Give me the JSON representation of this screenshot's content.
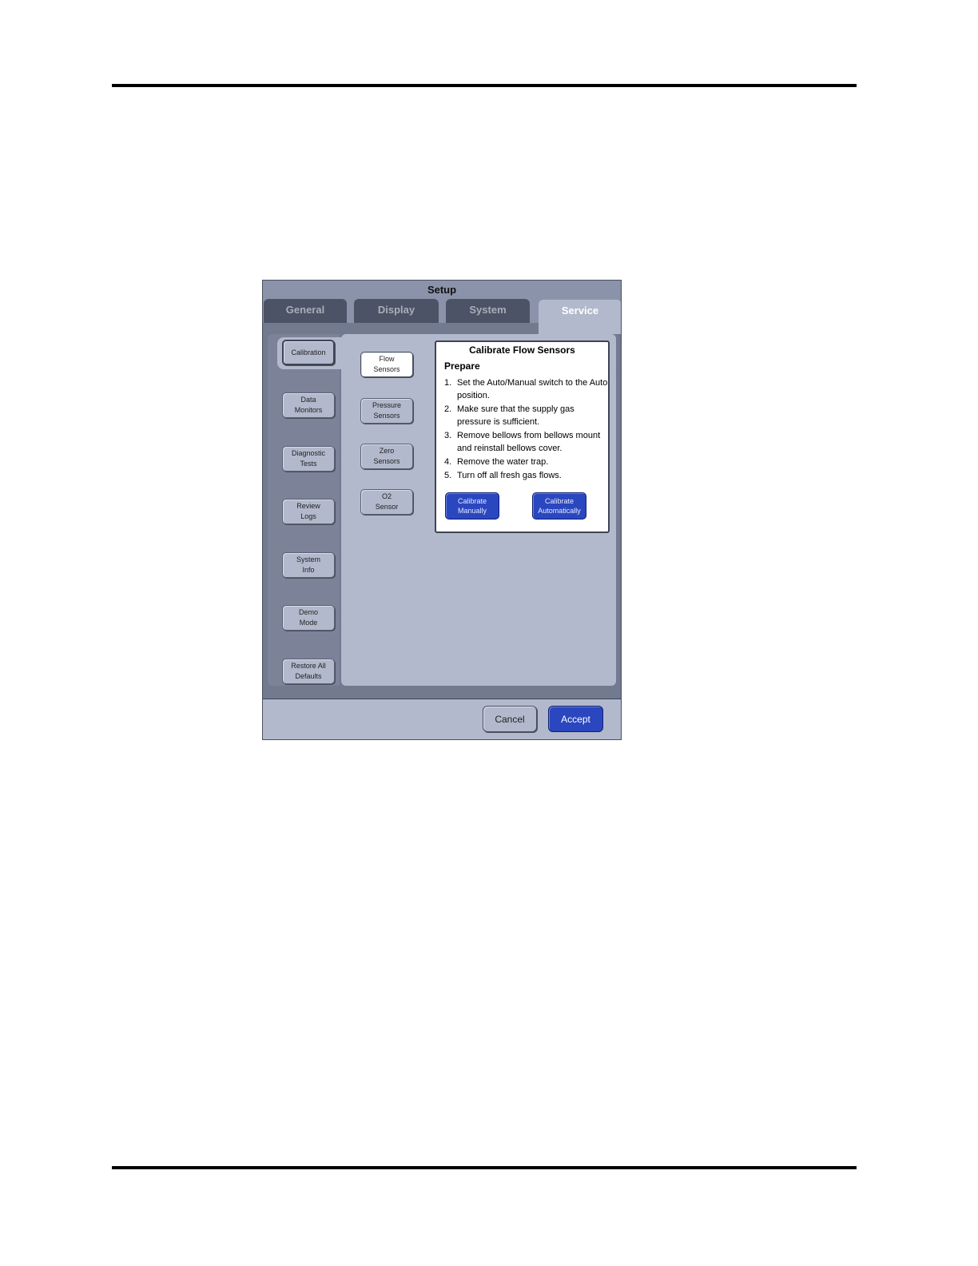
{
  "window": {
    "title": "Setup"
  },
  "tabs": [
    {
      "label": "General",
      "active": false
    },
    {
      "label": "Display",
      "active": false
    },
    {
      "label": "System",
      "active": false
    },
    {
      "label": "Service",
      "active": true
    }
  ],
  "sidebar": {
    "items": [
      {
        "label": "Calibration",
        "selected": true
      },
      {
        "label": "Data\nMonitors",
        "selected": false
      },
      {
        "label": "Diagnostic\nTests",
        "selected": false
      },
      {
        "label": "Review\nLogs",
        "selected": false
      },
      {
        "label": "System\nInfo",
        "selected": false
      },
      {
        "label": "Demo\nMode",
        "selected": false
      },
      {
        "label": "Restore All\nDefaults",
        "selected": false
      }
    ]
  },
  "calibration_menu": {
    "items": [
      {
        "label": "Flow\nSensors",
        "selected": true
      },
      {
        "label": "Pressure\nSensors",
        "selected": false
      },
      {
        "label": "Zero\nSensors",
        "selected": false
      },
      {
        "label": "O2\nSensor",
        "selected": false
      }
    ]
  },
  "panel": {
    "title": "Calibrate Flow Sensors",
    "subtitle": "Prepare",
    "steps": [
      {
        "num": "1.",
        "text": "Set the Auto/Manual switch to the Auto position."
      },
      {
        "num": "2.",
        "text": "Make sure that the supply gas pressure is sufficient."
      },
      {
        "num": "3.",
        "text": "Remove bellows from bellows mount and reinstall bellows cover."
      },
      {
        "num": "4.",
        "text": "Remove the water trap."
      },
      {
        "num": "5.",
        "text": "Turn off all fresh gas flows."
      }
    ],
    "calibrate_manually_label": "Calibrate\nManually",
    "calibrate_automatically_label": "Calibrate\nAutomatically"
  },
  "footer": {
    "cancel_label": "Cancel",
    "accept_label": "Accept"
  },
  "colors": {
    "accent_blue": "#2a47bf",
    "panel_bg": "#b3b9cc",
    "frame_dark": "#4d5366"
  }
}
